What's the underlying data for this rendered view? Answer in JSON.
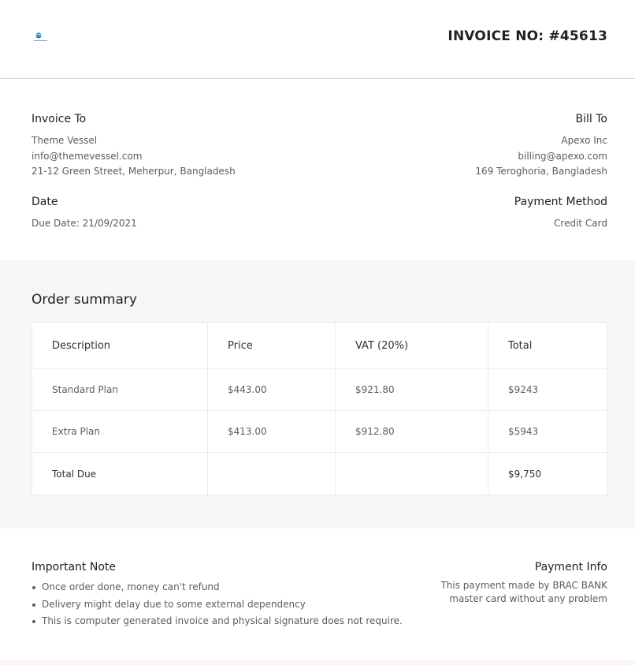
{
  "header": {
    "logo_name": "globe-logo-icon",
    "invoice_no": "INVOICE NO: #45613"
  },
  "invoice_to": {
    "title": "Invoice To",
    "name": "Theme Vessel",
    "email": "info@themevessel.com",
    "address": "21-12 Green Street, Meherpur, Bangladesh"
  },
  "bill_to": {
    "title": "Bill To",
    "name": "Apexo Inc",
    "email": "billing@apexo.com",
    "address": "169 Teroghoria, Bangladesh"
  },
  "date": {
    "title": "Date",
    "due": "Due Date: 21/09/2021"
  },
  "payment_method": {
    "title": "Payment Method",
    "value": "Credit Card"
  },
  "order_summary": {
    "title": "Order summary",
    "columns": [
      "Description",
      "Price",
      "VAT (20%)",
      "Total"
    ],
    "rows": [
      [
        "Standard Plan",
        "$443.00",
        "$921.80",
        "$9243"
      ],
      [
        "Extra Plan",
        "$413.00",
        "$912.80",
        "$5943"
      ]
    ],
    "total_label": "Total Due",
    "total_value": "$9,750"
  },
  "important_note": {
    "title": "Important Note",
    "items": [
      "Once order done, money can't refund",
      "Delivery might delay due to some external dependency",
      "This is computer generated invoice and physical signature does not require."
    ]
  },
  "payment_info": {
    "title": "Payment Info",
    "text": "This payment made by BRAC BANK master card without any problem"
  },
  "colors": {
    "summary_bg": "#f6f6f6",
    "logo_blue": "#2b8fd6"
  }
}
